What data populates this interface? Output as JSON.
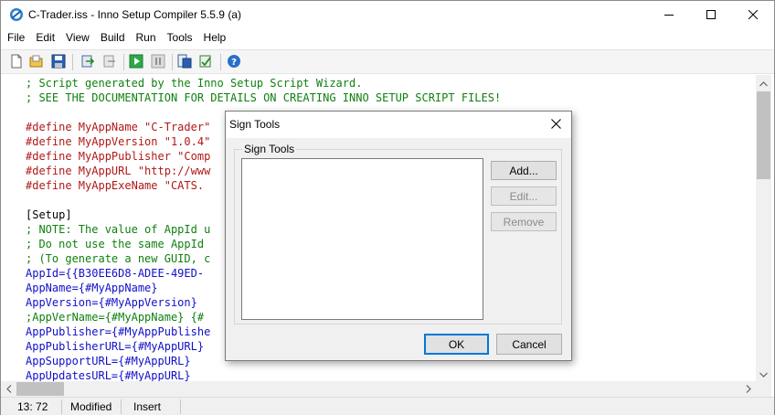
{
  "window": {
    "title": "C-Trader.iss - Inno Setup Compiler 5.5.9 (a)",
    "app_icon": "inno-setup-icon",
    "controls": [
      "minimize-icon",
      "maximize-icon",
      "close-icon"
    ]
  },
  "menu": [
    "File",
    "Edit",
    "View",
    "Build",
    "Run",
    "Tools",
    "Help"
  ],
  "toolbar": {
    "buttons": [
      "new-file-icon",
      "open-file-icon",
      "save-icon",
      "compile-icon",
      "stop-compile-icon",
      "run-icon",
      "pause-icon",
      "target-setup-icon",
      "target-uninstall-icon",
      "help-icon"
    ]
  },
  "editor": {
    "lines": [
      {
        "t": "; Script generated by the Inno Setup Script Wizard.",
        "k": "comment"
      },
      {
        "t": "; SEE THE DOCUMENTATION FOR DETAILS ON CREATING INNO SETUP SCRIPT FILES!",
        "k": "comment"
      },
      {
        "t": "",
        "k": "plain"
      },
      {
        "t": "#define MyAppName \"C-Trader\"",
        "k": "define"
      },
      {
        "t": "#define MyAppVersion \"1.0.4\"",
        "k": "define"
      },
      {
        "t": "#define MyAppPublisher \"Comp",
        "k": "define"
      },
      {
        "t": "#define MyAppURL \"http://www",
        "k": "define"
      },
      {
        "t": "#define MyAppExeName \"CATS.",
        "k": "define"
      },
      {
        "t": "",
        "k": "plain"
      },
      {
        "t": "[Setup]",
        "k": "section"
      },
      {
        "t": "; NOTE: The value of AppId u",
        "k": "comment"
      },
      {
        "t": "; Do not use the same AppId",
        "k": "comment"
      },
      {
        "t": "; (To generate a new GUID, c",
        "k": "comment"
      },
      {
        "t": "AppId={{B30EE6D8-ADEE-49ED-",
        "k": "key"
      },
      {
        "t": "AppName={#MyAppName}",
        "k": "key"
      },
      {
        "t": "AppVersion={#MyAppVersion}",
        "k": "key"
      },
      {
        "t": ";AppVerName={#MyAppName} {#",
        "k": "comment"
      },
      {
        "t": "AppPublisher={#MyAppPublishe",
        "k": "key"
      },
      {
        "t": "AppPublisherURL={#MyAppURL}",
        "k": "key"
      },
      {
        "t": "AppSupportURL={#MyAppURL}",
        "k": "key"
      },
      {
        "t": "AppUpdatesURL={#MyAppURL}",
        "k": "key"
      }
    ]
  },
  "status": {
    "position": "13: 72",
    "modified": "Modified",
    "mode": "Insert"
  },
  "dialog": {
    "title": "Sign Tools",
    "group_label": "Sign Tools",
    "buttons": {
      "add": "Add...",
      "edit": "Edit...",
      "remove": "Remove",
      "ok": "OK",
      "cancel": "Cancel"
    }
  }
}
